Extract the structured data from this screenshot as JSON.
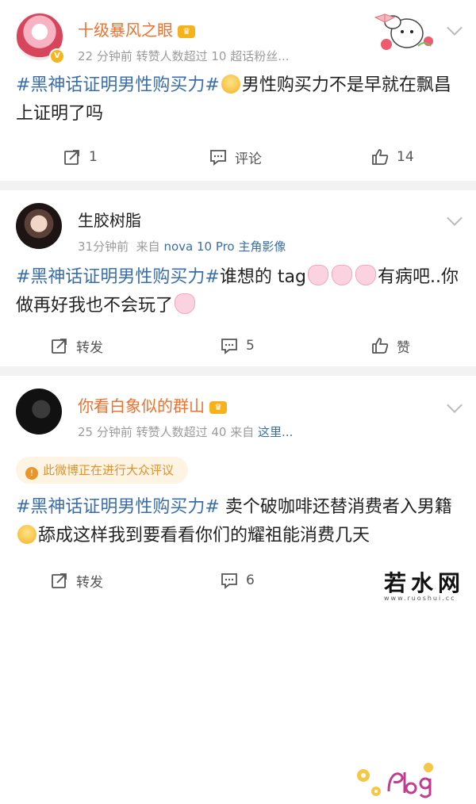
{
  "posts": [
    {
      "user": "十级暴风之眼",
      "meta": "22 分钟前  转赞人数超过 10  超话粉丝...",
      "text_tag": "#黑神话证明男性购买力#",
      "text_body": "男性购买力不是早就在飘昌上证明了吗",
      "actions": {
        "repost": "1",
        "comment": "评论",
        "like": "14"
      }
    },
    {
      "user": "生胶树脂",
      "meta_time": "31分钟前",
      "meta_from": "来自",
      "meta_source": "nova 10 Pro 主角影像",
      "text_tag": "#黑神话证明男性购买力#",
      "text_body1": "谁想的 tag",
      "text_body2": "有病吧..你做再好我也不会玩了",
      "actions": {
        "repost": "转发",
        "comment": "5",
        "like": "赞"
      }
    },
    {
      "user": "你看白象似的群山",
      "meta": "25 分钟前  转赞人数超过 40  来自",
      "meta_source": "这里...",
      "notice": "此微博正在进行大众评议",
      "text_tag": "#黑神话证明男性购买力#",
      "text_body1": " 卖个破咖啡还替消费者入男籍",
      "text_body2": "舔成这样我到要看看你们的耀祖能消费几天",
      "actions": {
        "repost": "转发",
        "comment": "6"
      }
    }
  ],
  "watermark": {
    "big": "若水网",
    "small": "www.ruoshui.cc"
  },
  "colors": {
    "tag": "#3a6ea8",
    "vip_name": "#f0702e",
    "notice_bg": "#fdf4e3",
    "notice_text": "#e1912d"
  }
}
